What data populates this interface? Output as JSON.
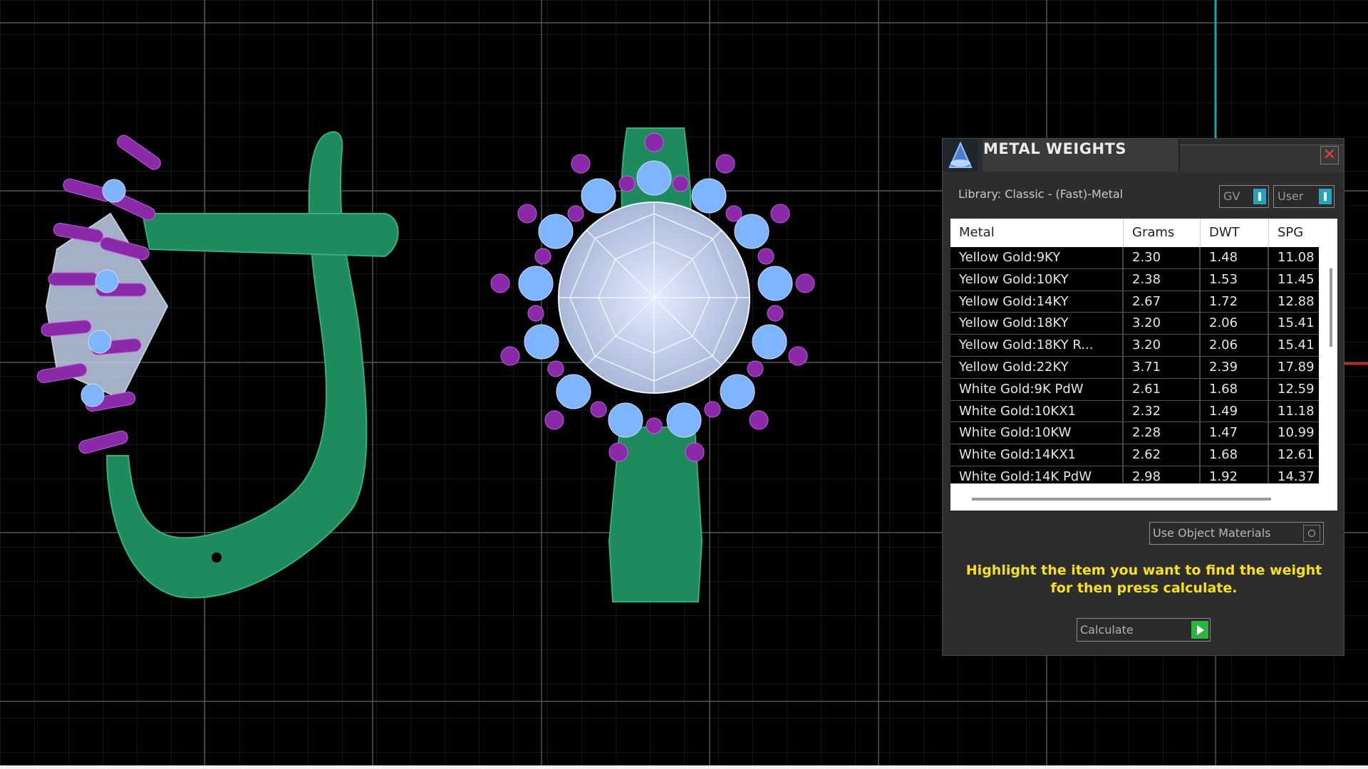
{
  "panel": {
    "title": "METAL WEIGHTS",
    "close_symbol": "✕",
    "library_label": "Library: Classic - (Fast)-Metal",
    "toggles": [
      {
        "label": "GV",
        "state": "on"
      },
      {
        "label": "User",
        "state": "on"
      }
    ],
    "table": {
      "columns": [
        "Metal",
        "Grams",
        "DWT",
        "SPG"
      ],
      "rows": [
        [
          "Yellow Gold:9KY",
          "2.30",
          "1.48",
          "11.08"
        ],
        [
          "Yellow Gold:10KY",
          "2.38",
          "1.53",
          "11.45"
        ],
        [
          "Yellow Gold:14KY",
          "2.67",
          "1.72",
          "12.88"
        ],
        [
          "Yellow Gold:18KY",
          "3.20",
          "2.06",
          "15.41"
        ],
        [
          "Yellow Gold:18KY R...",
          "3.20",
          "2.06",
          "15.41"
        ],
        [
          "Yellow Gold:22KY",
          "3.71",
          "2.39",
          "17.89"
        ],
        [
          "White Gold:9K PdW",
          "2.61",
          "1.68",
          "12.59"
        ],
        [
          "White Gold:10KX1",
          "2.32",
          "1.49",
          "11.18"
        ],
        [
          "White Gold:10KW",
          "2.28",
          "1.47",
          "10.99"
        ],
        [
          "White Gold:14KX1",
          "2.62",
          "1.68",
          "12.61"
        ],
        [
          "White Gold:14K PdW",
          "2.98",
          "1.92",
          "14.37"
        ]
      ]
    },
    "use_object_materials_label": "Use Object Materials",
    "hint_line1": "Highlight the item you want to find the weight",
    "hint_line2": "for then press calculate.",
    "calculate_label": "Calculate",
    "colors": {
      "hint": "#f7e11a",
      "toggle_on": "#2aa3b8",
      "calculate_play": "#2fb53f"
    }
  },
  "viewport": {
    "colors": {
      "background": "#000000",
      "grid": "#4a4a4a",
      "shank": "#1f8a5e",
      "stone": "#c9dcff",
      "prong": "#8a2aa8",
      "accent_stone": "#7fb4ff",
      "axis_cyan": "#1aa8b0",
      "axis_red": "#d02020"
    }
  }
}
